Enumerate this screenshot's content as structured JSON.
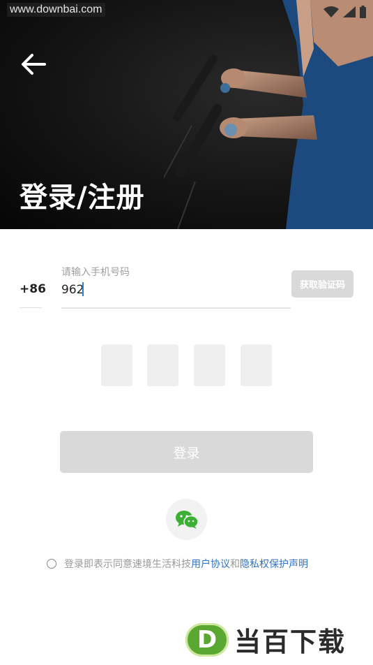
{
  "watermark_top": "www.downbai.com",
  "header": {
    "title": "登录/注册"
  },
  "phone": {
    "country_code": "+86",
    "label": "请输入手机号码",
    "value": "962"
  },
  "get_code_label": "获取验证码",
  "code_boxes": [
    "",
    "",
    "",
    ""
  ],
  "login_label": "登录",
  "agreement": {
    "prefix": "登录即表示同意速境生活科技",
    "user_agreement": "用户协议",
    "and": "和",
    "privacy": "隐私权保护声明"
  },
  "brand": {
    "badge": "D",
    "name": "当百下载"
  },
  "colors": {
    "link": "#2f73c4",
    "disabled_button": "#d9d9d9",
    "wechat_green": "#3cb034",
    "caret": "#2d7fd3"
  },
  "icons": [
    "back-arrow-icon",
    "wifi-icon",
    "signal-icon",
    "battery-icon",
    "wechat-icon"
  ]
}
